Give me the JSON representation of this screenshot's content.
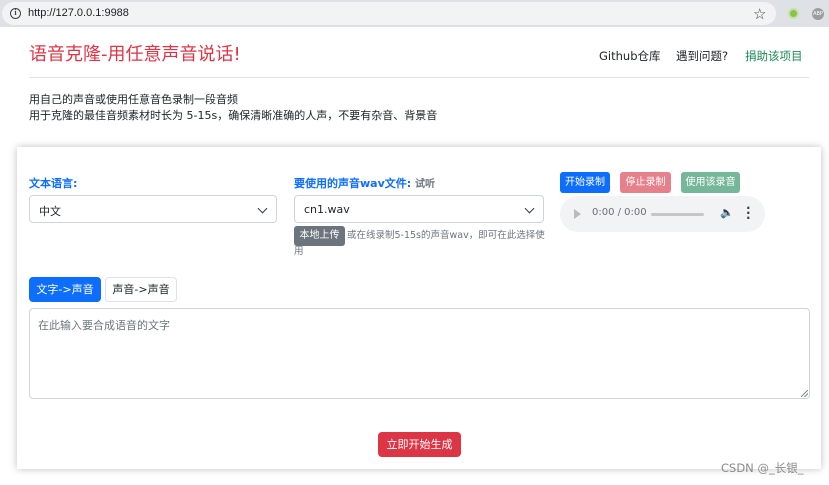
{
  "browser": {
    "url": "http://127.0.0.1:9988",
    "ext_label": "ABP"
  },
  "header": {
    "title": "语音克隆-用任意声音说话!",
    "nav": {
      "github": "Github仓库",
      "issues": "遇到问题?",
      "donate": "捐助该项目"
    }
  },
  "intro": {
    "line1": "用自己的声音或使用任意音色录制一段音频",
    "line2": "用于克隆的最佳音频素材时长为 5-15s，确保清晰准确的人声，不要有杂音、背景音"
  },
  "form": {
    "language_label": "文本语言:",
    "language_value": "中文",
    "voice_label": "要使用的声音wav文件:",
    "voice_hint": "试听",
    "voice_value": "cn1.wav",
    "upload_button": "本地上传",
    "upload_hint": "或在线录制5-15s的声音wav，即可在此选择使用",
    "record_start": "开始录制",
    "record_stop": "停止录制",
    "record_use": "使用该录音",
    "audio_time": "0:00 / 0:00",
    "tab_text_to_speech": "文字->声音",
    "tab_speech_to_speech": "声音->声音",
    "text_placeholder": "在此输入要合成语音的文字",
    "generate_button": "立即开始生成"
  },
  "watermark": "CSDN @_长银_",
  "colors": {
    "primary": "#0d6efd",
    "danger": "#dc3545",
    "success": "#198754",
    "secondary": "#6c757d"
  }
}
